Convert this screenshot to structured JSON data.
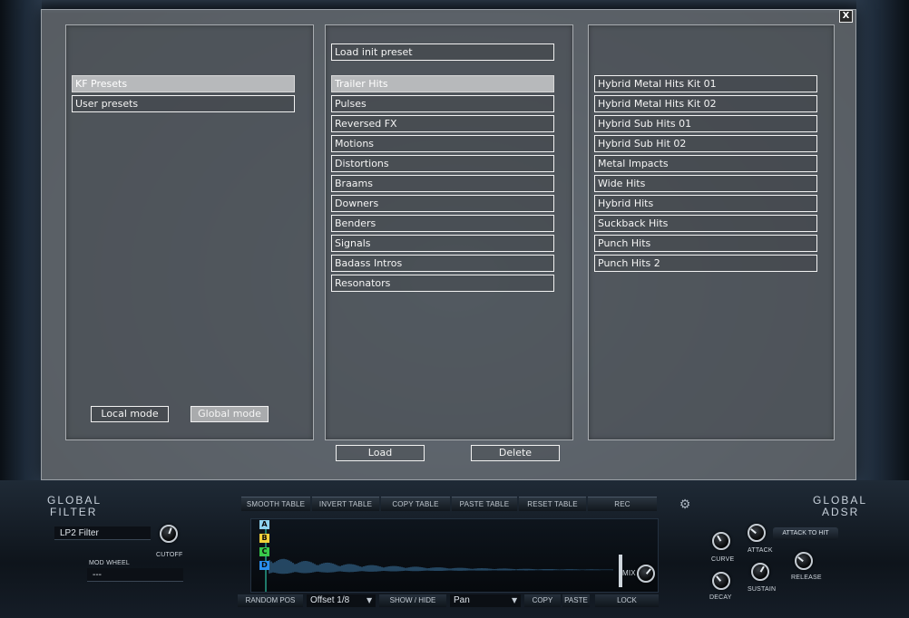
{
  "dialog": {
    "close_label": "X",
    "bank_list": [
      {
        "label": "KF Presets",
        "selected": true
      },
      {
        "label": "User presets",
        "selected": false
      }
    ],
    "mode_buttons": {
      "local": "Local mode",
      "global": "Global mode",
      "active": "global"
    },
    "load_init_label": "Load init preset",
    "category_list": [
      {
        "label": "Trailer Hits",
        "selected": true
      },
      {
        "label": "Pulses",
        "selected": false
      },
      {
        "label": "Reversed FX",
        "selected": false
      },
      {
        "label": "Motions",
        "selected": false
      },
      {
        "label": "Distortions",
        "selected": false
      },
      {
        "label": "Braams",
        "selected": false
      },
      {
        "label": "Downers",
        "selected": false
      },
      {
        "label": "Benders",
        "selected": false
      },
      {
        "label": "Signals",
        "selected": false
      },
      {
        "label": "Badass Intros",
        "selected": false
      },
      {
        "label": "Resonators",
        "selected": false
      }
    ],
    "preset_list": [
      "Hybrid Metal Hits Kit 01",
      "Hybrid Metal Hits Kit 02",
      "Hybrid Sub Hits 01",
      "Hybrid Sub Hit 02",
      "Metal Impacts",
      "Wide Hits",
      "Hybrid Hits",
      "Suckback Hits",
      "Punch Hits",
      "Punch Hits 2"
    ],
    "load_label": "Load",
    "delete_label": "Delete"
  },
  "global_filter": {
    "title_line1": "GLOBAL",
    "title_line2": "FILTER",
    "filter_type": "LP2 Filter",
    "cutoff_label": "CUTOFF",
    "mod_wheel_label": "MOD WHEEL",
    "mod_wheel_value": "---"
  },
  "table_toolbar": {
    "smooth": "SMOOTH TABLE",
    "invert": "INVERT TABLE",
    "copy": "COPY TABLE",
    "paste": "PASTE TABLE",
    "reset": "RESET TABLE",
    "rec": "REC"
  },
  "layers": [
    "A",
    "B",
    "C",
    "D"
  ],
  "layer_colors": {
    "A": "#8fd3f0",
    "B": "#f2d23a",
    "C": "#38c94a",
    "D": "#2a8ff0"
  },
  "mix_label": "MIX",
  "bottom_bar": {
    "random_pos": "RANDOM POS",
    "offset": "Offset 1/8",
    "show_hide": "SHOW / HIDE",
    "pan": "Pan",
    "copy": "COPY",
    "paste": "PASTE",
    "lock": "LOCK"
  },
  "global_adsr": {
    "title_line1": "GLOBAL",
    "title_line2": "ADSR",
    "curve": "CURVE",
    "attack": "ATTACK",
    "attack_to_hit": "ATTACK TO HIT",
    "decay": "DECAY",
    "sustain": "SUSTAIN",
    "release": "RELEASE"
  }
}
